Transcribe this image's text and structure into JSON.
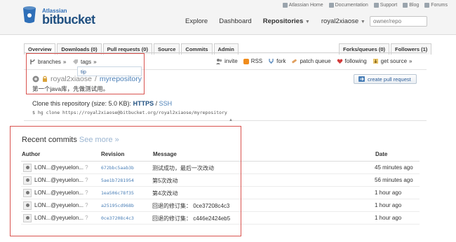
{
  "header": {
    "brand_small": "Atlassian",
    "brand": "bitbucket",
    "toplinks": [
      "Atlassian Home",
      "Documentation",
      "Support",
      "Blog",
      "Forums"
    ],
    "nav": [
      {
        "label": "Explore"
      },
      {
        "label": "Dashboard"
      },
      {
        "label": "Repositories"
      },
      {
        "label": "royal2xiaose"
      }
    ],
    "search_placeholder": "owner/repo"
  },
  "tabs": [
    "Overview",
    "Downloads (0)",
    "Pull requests (0)",
    "Source",
    "Commits",
    "Admin"
  ],
  "tabs_right": [
    "Forks/queues (0)",
    "Followers (1)"
  ],
  "subbar": {
    "branches": "branches",
    "tags": "tags",
    "tip": "tip",
    "actions": [
      "invite",
      "RSS",
      "fork",
      "patch queue",
      "following",
      "get source"
    ]
  },
  "repo": {
    "owner": "royal2xiaose",
    "separator": "/",
    "name": "myrepository",
    "description": "第一个java库，先做测试用。",
    "create_pr": "create pull request",
    "clone_label": "Clone this repository (size: 5.0 KB):",
    "https": "HTTPS",
    "ssh": "SSH",
    "clone_cmd": "$ hg clone https://royal2xiaose@bitbucket.org/royal2xiaose/myrepository"
  },
  "commits": {
    "title": "Recent commits",
    "see_more": "See more »",
    "headers": {
      "author": "Author",
      "revision": "Revision",
      "message": "Message",
      "date": "Date"
    },
    "rows": [
      {
        "author": "LON...@yeyuelon...",
        "q": "?",
        "rev": "672bbc5aab3b",
        "msg": "测试成功，最后一次改动",
        "date": "45 minutes ago"
      },
      {
        "author": "LON...@yeyuelon...",
        "q": "?",
        "rev": "5ae1b7281954",
        "msg": "第5次改动",
        "date": "56 minutes ago"
      },
      {
        "author": "LON...@yeyuelon...",
        "q": "?",
        "rev": "1ea506c78f35",
        "msg": "第4次改动",
        "date": "1 hour ago"
      },
      {
        "author": "LON...@yeyuelon...",
        "q": "?",
        "rev": "a25195cd968b",
        "msg": "回退的修订集： 0ce37208c4c3",
        "date": "1 hour ago"
      },
      {
        "author": "LON...@yeyuelon...",
        "q": "?",
        "rev": "0ce37208c4c3",
        "msg": "回退的修订集： c446e2424eb5",
        "date": "1 hour ago"
      }
    ]
  }
}
